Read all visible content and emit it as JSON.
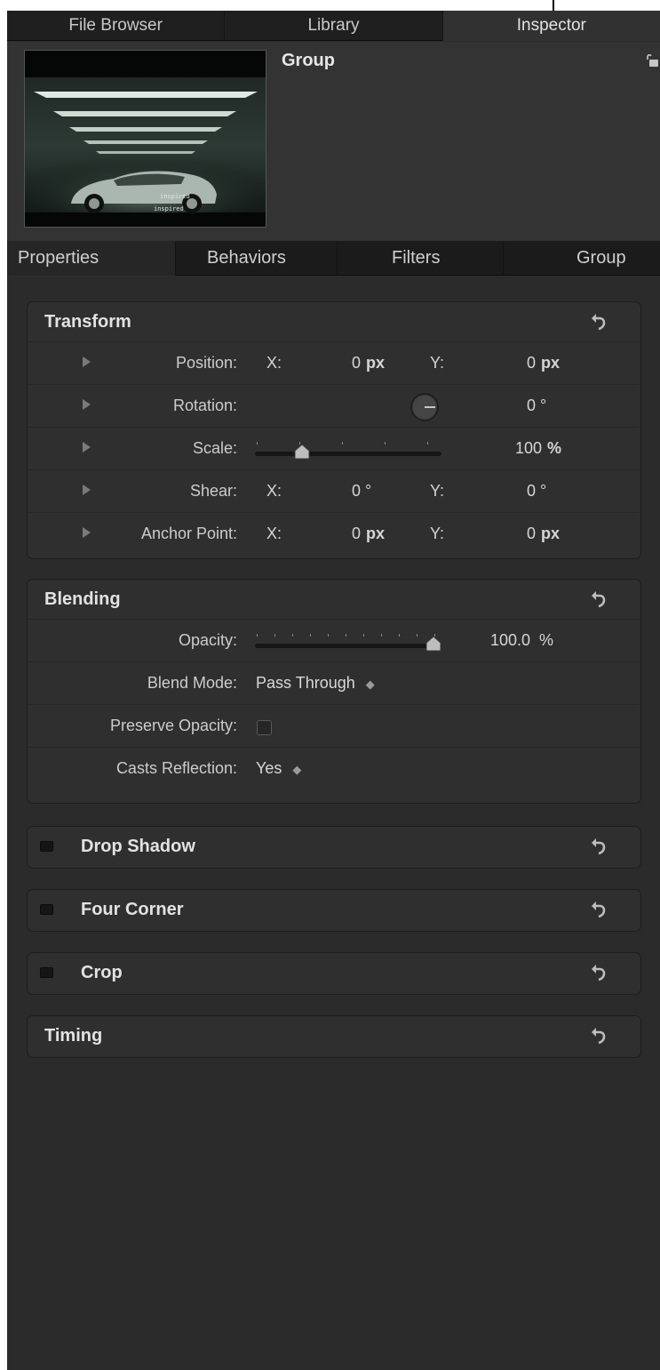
{
  "top_tabs": [
    "File Browser",
    "Library",
    "Inspector"
  ],
  "object_name": "Group",
  "thumbnail_text": [
    "inspired",
    "inspired"
  ],
  "sub_tabs": [
    "Properties",
    "Behaviors",
    "Filters",
    "Group"
  ],
  "transform": {
    "title": "Transform",
    "position": {
      "label": "Position:",
      "x_label": "X:",
      "x": "0",
      "x_unit": "px",
      "y_label": "Y:",
      "y": "0",
      "y_unit": "px"
    },
    "rotation": {
      "label": "Rotation:",
      "value": "0",
      "unit": "°"
    },
    "scale": {
      "label": "Scale:",
      "value": "100",
      "unit": "%",
      "slider_fraction": 0.25
    },
    "shear": {
      "label": "Shear:",
      "x_label": "X:",
      "x": "0",
      "x_unit": "°",
      "y_label": "Y:",
      "y": "0",
      "y_unit": "°"
    },
    "anchor": {
      "label": "Anchor Point:",
      "x_label": "X:",
      "x": "0",
      "x_unit": "px",
      "y_label": "Y:",
      "y": "0",
      "y_unit": "px"
    }
  },
  "blending": {
    "title": "Blending",
    "opacity": {
      "label": "Opacity:",
      "value": "100.0",
      "unit": "%",
      "slider_fraction": 1.0
    },
    "blend_mode": {
      "label": "Blend Mode:",
      "value": "Pass Through"
    },
    "preserve_opacity": {
      "label": "Preserve Opacity:",
      "checked": false
    },
    "casts_reflection": {
      "label": "Casts Reflection:",
      "value": "Yes"
    }
  },
  "collapsed_sections": [
    {
      "title": "Drop Shadow",
      "enabled": false
    },
    {
      "title": "Four Corner",
      "enabled": false
    },
    {
      "title": "Crop",
      "enabled": false
    }
  ],
  "timing": {
    "title": "Timing"
  },
  "colors": {
    "panel": "#2c2c2c",
    "section": "#2f2f2f",
    "text": "#d2d2d2"
  },
  "icons": {
    "reset": "reset-arrow-icon",
    "lock": "lock-icon",
    "disclosure": "disclosure-triangle-icon",
    "popup": "up-down-arrows-icon"
  }
}
